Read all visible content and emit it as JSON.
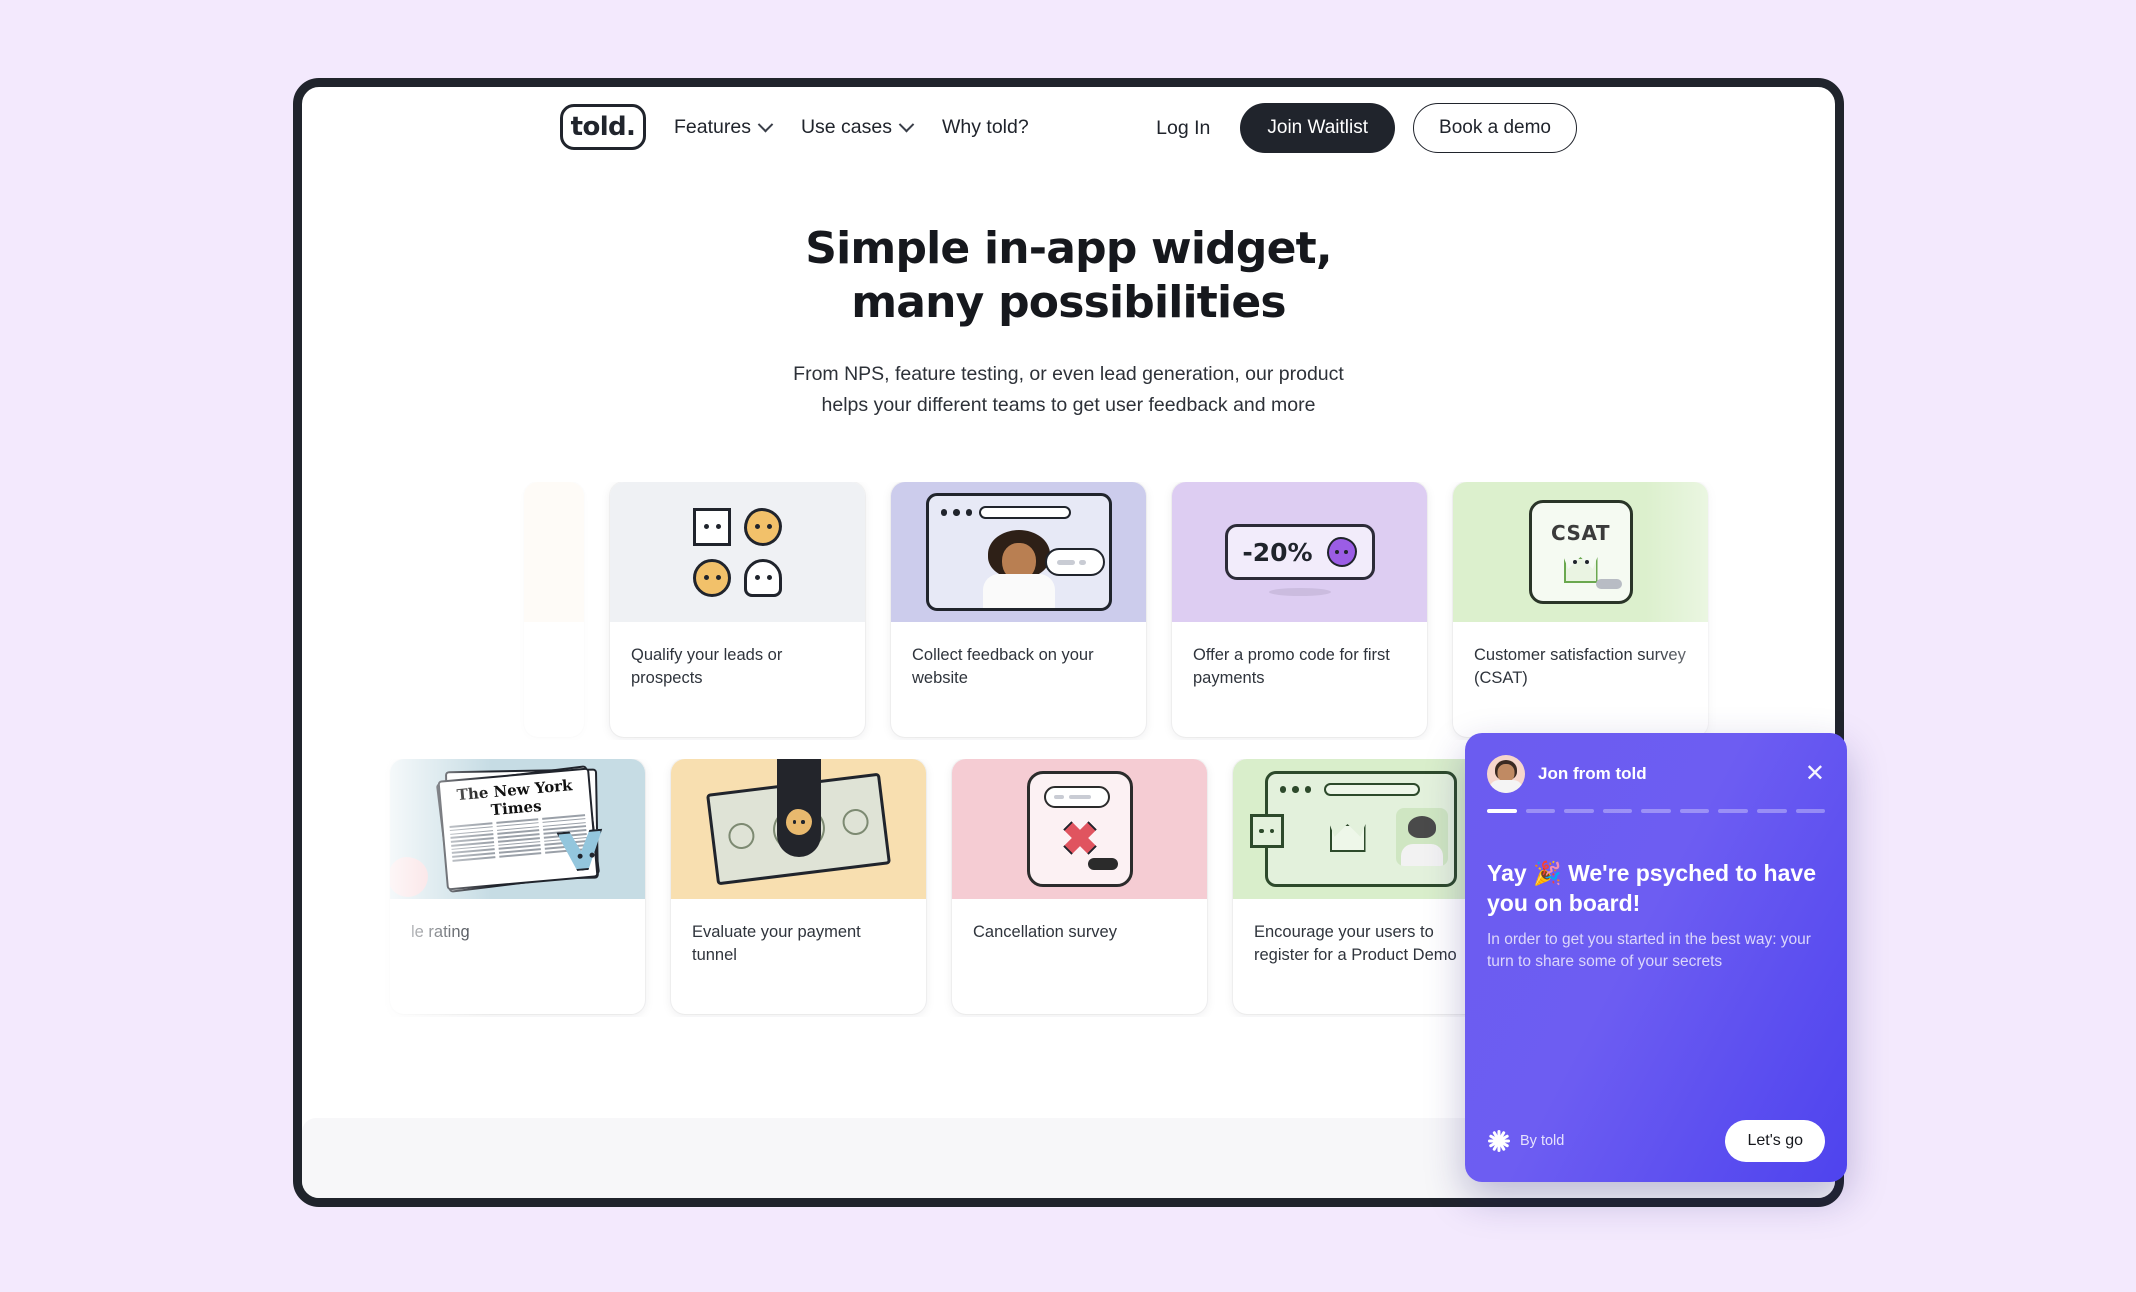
{
  "theme": {
    "page_bg": "#f3e9fd",
    "frame_border": "#20242c",
    "accent": "#5b4ef0",
    "dark_button": "#20242c"
  },
  "nav": {
    "logo_text": "told.",
    "links": [
      {
        "label": "Features",
        "has_dropdown": true,
        "icon": "chevron-down-icon"
      },
      {
        "label": "Use cases",
        "has_dropdown": true,
        "icon": "chevron-down-icon"
      },
      {
        "label": "Why told?",
        "has_dropdown": false
      }
    ],
    "login_label": "Log In",
    "primary_cta": "Join Waitlist",
    "secondary_cta": "Book a demo"
  },
  "hero": {
    "title_line1": "Simple in-app widget,",
    "title_line2": "many possibilities",
    "subtitle_line1": "From NPS, feature testing, or even lead generation, our product",
    "subtitle_line2": "helps your different teams to get user feedback and more"
  },
  "carousel_rows": [
    {
      "id": "row-1",
      "cards": [
        {
          "caption": "",
          "art": "peek-left",
          "bg": "#fbf0dd",
          "partial": true
        },
        {
          "caption": "Qualify your leads or prospects",
          "art": "face-shapes",
          "bg": "#eff1f4"
        },
        {
          "caption": "Collect feedback on your website",
          "art": "browser-person",
          "bg": "#ccccec"
        },
        {
          "caption": "Offer a promo code for first payments",
          "art": "promo-badge",
          "bg": "#ddcdf2"
        },
        {
          "caption": "Customer satisfaction survey (CSAT)",
          "art": "csat-card",
          "bg": "#dcf0cd"
        }
      ]
    },
    {
      "id": "row-2",
      "cards": [
        {
          "caption": "le rating",
          "art": "newspaper",
          "bg": "#c6dce4",
          "partial": true
        },
        {
          "caption": "Evaluate your payment tunnel",
          "art": "dollar-tunnel",
          "bg": "#f8dfb0"
        },
        {
          "caption": "Cancellation survey",
          "art": "phone-x",
          "bg": "#f5ccd3"
        },
        {
          "caption": "Encourage your users to register for a Product Demo",
          "art": "green-browser",
          "bg": "#d9eecb"
        }
      ]
    }
  ],
  "widget": {
    "sender_name": "Jon from told",
    "close_icon": "close-icon",
    "avatar": "avatar",
    "progress_total": 9,
    "progress_current": 1,
    "title": "Yay 🎉 We're psyched to have you on board!",
    "subtitle": "In order to get you started in the best way: your turn to share some of your secrets",
    "branding_label": "By told",
    "branding_icon": "starburst-icon",
    "cta_label": "Let's go",
    "bg_color": "#5b4ef0"
  }
}
